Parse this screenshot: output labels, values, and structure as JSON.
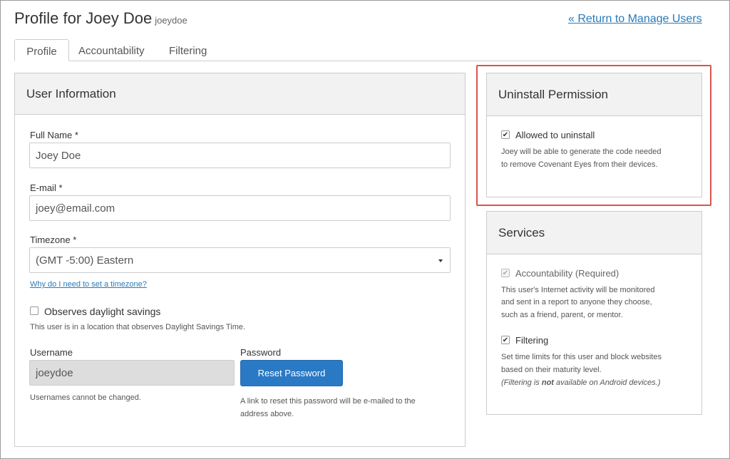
{
  "header": {
    "title": "Profile for Joey Doe",
    "username_small": "joeydoe",
    "return_link": "« Return to Manage Users"
  },
  "tabs": [
    {
      "label": "Profile",
      "active": true
    },
    {
      "label": "Accountability",
      "active": false
    },
    {
      "label": "Filtering",
      "active": false
    }
  ],
  "user_info": {
    "title": "User Information",
    "full_name_label": "Full Name *",
    "full_name_value": "Joey Doe",
    "email_label": "E-mail *",
    "email_value": "joey@email.com",
    "timezone_label": "Timezone *",
    "timezone_value": "(GMT -5:00) Eastern",
    "timezone_help_link": "Why do I need to set a timezone?",
    "dst_label": "Observes daylight savings",
    "dst_checked": false,
    "dst_help": "This user is in a location that observes Daylight Savings Time.",
    "username_label": "Username",
    "username_value": "joeydoe",
    "username_help": "Usernames cannot be changed.",
    "password_label": "Password",
    "reset_button": "Reset Password",
    "password_help_1": "A link to reset this password will be e-mailed to the",
    "password_help_2": "address above."
  },
  "uninstall": {
    "title": "Uninstall Permission",
    "allowed_label": "Allowed to uninstall",
    "allowed_checked": true,
    "desc_1": "Joey will be able to generate the code needed",
    "desc_2": "to remove Covenant Eyes from their devices.",
    "highlight_color": "#d9534f"
  },
  "services": {
    "title": "Services",
    "accountability_label": "Accountability (Required)",
    "accountability_checked": true,
    "accountability_desc_1": "This user's Internet activity will be monitored",
    "accountability_desc_2": "and sent in a report to anyone they choose,",
    "accountability_desc_3": "such as a friend, parent, or mentor.",
    "filtering_label": "Filtering",
    "filtering_checked": true,
    "filtering_desc_1": "Set time limits for this user and block websites",
    "filtering_desc_2": "based on their maturity level.",
    "filtering_note_pre": "(Filtering is ",
    "filtering_note_bold": "not",
    "filtering_note_post": " available on Android devices.)"
  },
  "colors": {
    "link": "#2a7ab8",
    "primary_button": "#2a79c4",
    "panel_header_bg": "#f2f2f2"
  }
}
